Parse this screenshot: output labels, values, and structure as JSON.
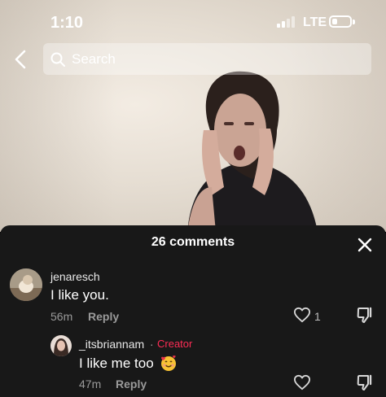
{
  "status_bar": {
    "time": "1:10",
    "network": "LTE",
    "battery_level": 0.25
  },
  "search": {
    "placeholder": "Search"
  },
  "comments_sheet": {
    "title": "26 comments",
    "comments": [
      {
        "username": "jenaresch",
        "text": "I like you.",
        "age": "56m",
        "reply_label": "Reply",
        "likes": "1"
      },
      {
        "username": "_itsbriannam",
        "separator": "·",
        "badge": "Creator",
        "text": "I like me too",
        "emoji": "smiling-face-with-hearts",
        "age": "47m",
        "reply_label": "Reply"
      }
    ]
  },
  "icons": [
    "back-icon",
    "search-icon",
    "close-icon",
    "heart-icon",
    "dislike-icon"
  ],
  "colors": {
    "sheet_background": "#181818",
    "creator_badge": "#fe2c55"
  }
}
